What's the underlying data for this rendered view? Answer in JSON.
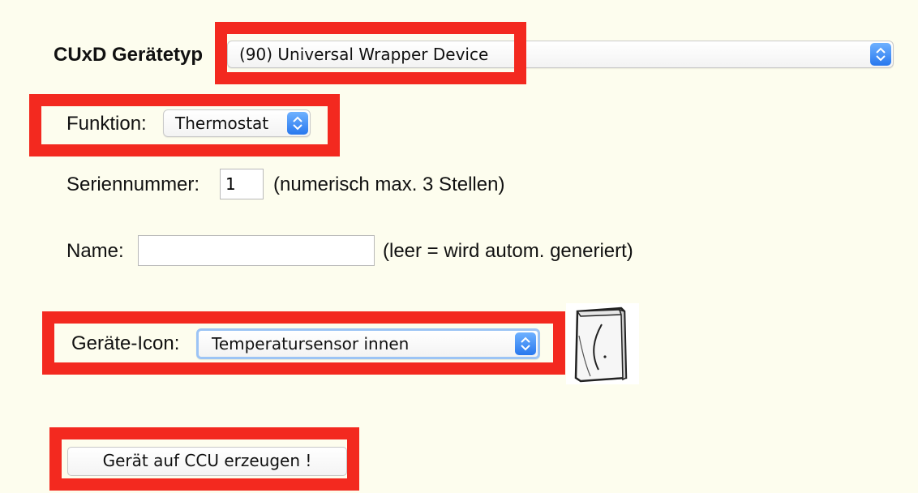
{
  "form": {
    "device_type": {
      "label": "CUxD Gerätetyp",
      "value": "(90) Universal Wrapper Device"
    },
    "function": {
      "label": "Funktion:",
      "value": "Thermostat"
    },
    "serial": {
      "label": "Seriennummer:",
      "value": "1",
      "hint": "(numerisch max. 3 Stellen)"
    },
    "name": {
      "label": "Name:",
      "value": "",
      "hint": "(leer = wird autom. generiert)"
    },
    "device_icon": {
      "label": "Geräte-Icon:",
      "value": "Temperatursensor innen",
      "preview_icon": "temperature-sensor-device-icon"
    },
    "create_button_label": "Gerät auf CCU erzeugen !"
  },
  "colors": {
    "background": "#fdfdee",
    "highlight": "#f3291f",
    "select_arrow": "#2878ee"
  }
}
